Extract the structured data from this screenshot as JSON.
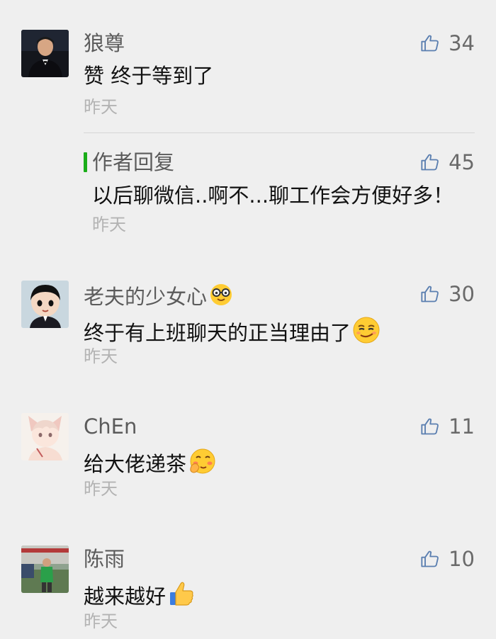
{
  "comments": [
    {
      "name": "狼尊",
      "text": "赞 终于等到了",
      "time": "昨天",
      "likes": "34",
      "avatar_icon": "avatar-man-suit"
    },
    {
      "name": "老夫的少女心",
      "name_emoji": "nerd-glasses-emoji",
      "text": "终于有上班聊天的正当理由了",
      "text_emoji": "smirk-emoji",
      "time": "昨天",
      "likes": "30",
      "avatar_icon": "avatar-cartoon-boy"
    },
    {
      "name": "ChEn",
      "text": "给大佬递茶",
      "text_emoji": "giggle-emoji",
      "time": "昨天",
      "likes": "11",
      "avatar_icon": "avatar-anime-foxboy"
    },
    {
      "name": "陈雨",
      "text": "越来越好",
      "text_emoji": "thumbs-up-emoji",
      "time": "昨天",
      "likes": "10",
      "avatar_icon": "avatar-person-green"
    }
  ],
  "author_reply": {
    "label": "作者回复",
    "text": "以后聊微信..啊不...聊工作会方便好多！",
    "time": "昨天",
    "likes": "45"
  },
  "colors": {
    "background": "#efefef",
    "reply_accent": "#1aad19",
    "like_icon": "#5b7fb0"
  }
}
